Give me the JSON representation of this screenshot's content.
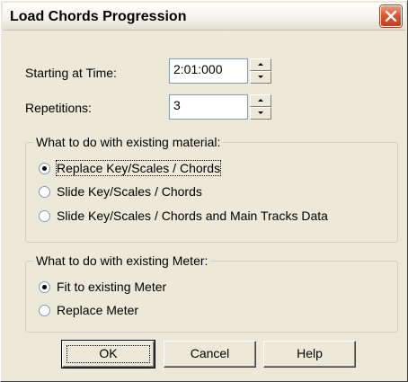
{
  "window": {
    "title": "Load Chords Progression"
  },
  "fields": {
    "starting_time_label": "Starting at Time:",
    "starting_time_value": "2:01:000",
    "repetitions_label": "Repetitions:",
    "repetitions_value": "3"
  },
  "existing_material": {
    "title": "What to do with existing material:",
    "options": [
      {
        "label": "Replace Key/Scales / Chords",
        "selected": true
      },
      {
        "label": "Slide Key/Scales / Chords",
        "selected": false
      },
      {
        "label": "Slide Key/Scales / Chords and Main Tracks Data",
        "selected": false
      }
    ]
  },
  "existing_meter": {
    "title": "What to do with existing Meter:",
    "options": [
      {
        "label": "Fit to existing Meter",
        "selected": true
      },
      {
        "label": "Replace Meter",
        "selected": false
      }
    ]
  },
  "buttons": {
    "ok": "OK",
    "cancel": "Cancel",
    "help": "Help"
  },
  "icons": {
    "close": "close-icon",
    "spin_up": "spin-up-icon",
    "spin_down": "spin-down-icon"
  }
}
